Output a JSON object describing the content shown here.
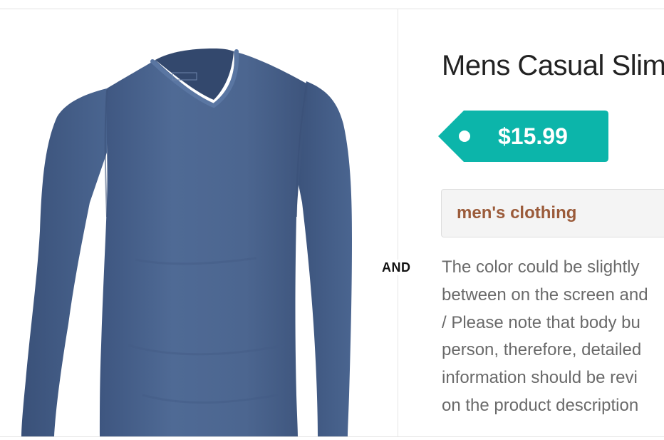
{
  "product": {
    "title": "Mens Casual Slim",
    "price": "$15.99",
    "category": "men's clothing",
    "description_lines": [
      "The color could be slightly",
      "between on the screen and",
      "/ Please note that body bu",
      "person, therefore, detailed",
      "information should be revi",
      "on the product description"
    ]
  },
  "separator": {
    "label": "AND"
  },
  "colors": {
    "price_tag": "#0cb5aa",
    "category_text": "#9b5b3a",
    "shirt": "#4c6691"
  },
  "image": {
    "subject": "blue long-sleeve v-neck t-shirt",
    "icon": "product-photo"
  }
}
